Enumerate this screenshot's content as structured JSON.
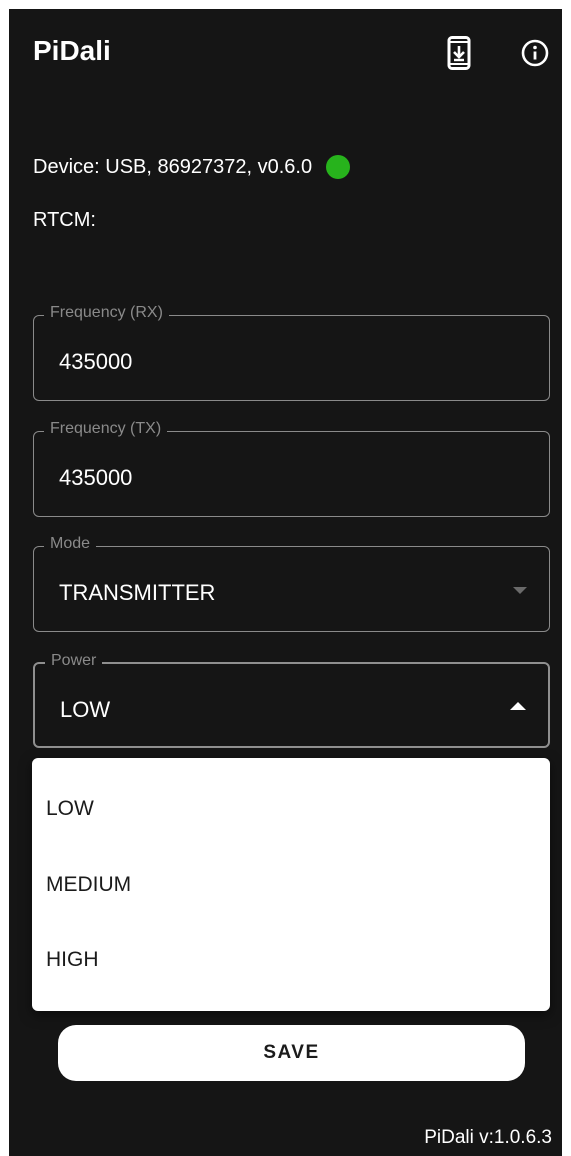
{
  "app": {
    "title": "PiDali",
    "version": "PiDali v:1.0.6.3"
  },
  "toolbar": {
    "icons": [
      "install-mobile-icon",
      "info-icon"
    ]
  },
  "status": {
    "device_text": "Device: USB, 86927372, v0.6.0",
    "device_indicator_color": "#27b31c",
    "rtcm_label": "RTCM:"
  },
  "form": {
    "frequency_rx": {
      "label": "Frequency (RX)",
      "value": "435000"
    },
    "frequency_tx": {
      "label": "Frequency (TX)",
      "value": "435000"
    },
    "mode": {
      "label": "Mode",
      "value": "TRANSMITTER"
    },
    "power": {
      "label": "Power",
      "value": "LOW",
      "open": true
    }
  },
  "power_menu": {
    "options": [
      "LOW",
      "MEDIUM",
      "HIGH"
    ]
  },
  "actions": {
    "save_label": "SAVE"
  },
  "colors": {
    "background": "#151515",
    "accent": "#ffffff",
    "outline": "#8a8a8a"
  }
}
